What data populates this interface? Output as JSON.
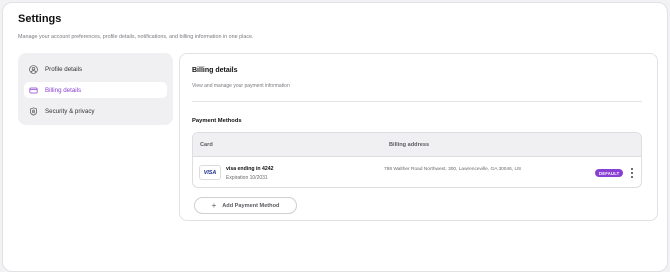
{
  "header": {
    "title": "Settings",
    "subtitle": "Manage your account preferences, profile details, notifications, and billing information in one place."
  },
  "sidebar": {
    "items": [
      {
        "label": "Profile details",
        "icon": "user-circle-icon",
        "active": false
      },
      {
        "label": "Billing details",
        "icon": "credit-card-icon",
        "active": true
      },
      {
        "label": "Security & privacy",
        "icon": "shield-icon",
        "active": false
      }
    ]
  },
  "billing": {
    "title": "Billing details",
    "subtitle": "View and manage your payment information",
    "payment_methods_heading": "Payment Methods",
    "table": {
      "columns": [
        "Card",
        "Billing address"
      ],
      "rows": [
        {
          "brand": "VISA",
          "card_name": "visa ending in 4242",
          "expiration": "Expiration 10/2031",
          "address": "798 Walther Road Northwest, 300, Lawrenceville, GA 30046, US",
          "badge": "DEFAULT"
        }
      ]
    },
    "add_button_label": "Add Payment Method"
  },
  "colors": {
    "accent": "#8a3fd4",
    "sidebar_bg": "#f0f0f3",
    "table_header_bg": "#f0f0f3"
  }
}
